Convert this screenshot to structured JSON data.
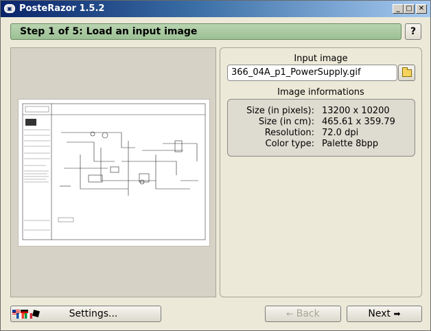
{
  "window": {
    "title": "PosteRazor 1.5.2",
    "controls": {
      "minimize": "_",
      "maximize": "□",
      "close": "✕"
    }
  },
  "header": {
    "step_title": "Step 1 of 5: Load an input image",
    "help_label": "?"
  },
  "input_image": {
    "label": "Input image",
    "filename": "366_04A_p1_PowerSupply.gif",
    "open_icon": "folder-open-icon"
  },
  "image_info": {
    "label": "Image informations",
    "rows": [
      {
        "key": "Size (in pixels):",
        "value": "13200 x 10200"
      },
      {
        "key": "Size (in cm):",
        "value": "465.61 x 359.79"
      },
      {
        "key": "Resolution:",
        "value": "72.0 dpi"
      },
      {
        "key": "Color type:",
        "value": "Palette 8bpp"
      }
    ]
  },
  "footer": {
    "settings_label": "Settings...",
    "back_label": "Back",
    "back_icon": "←",
    "next_label": "Next",
    "next_icon": "➡"
  },
  "colors": {
    "step_bar": "#9cc094",
    "window_bg": "#ece9d8",
    "preview_bg": "#d6d3c6"
  }
}
